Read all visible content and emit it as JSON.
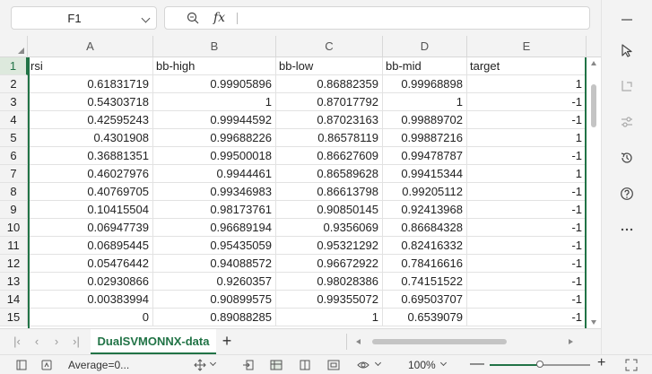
{
  "formula_bar": {
    "name_box": "F1",
    "fx_label": "fx",
    "formula_value": ""
  },
  "columns": [
    "A",
    "B",
    "C",
    "D",
    "E"
  ],
  "rows": [
    {
      "num": "1",
      "cells": [
        "rsi",
        "bb-high",
        "bb-low",
        "bb-mid",
        "target"
      ]
    },
    {
      "num": "2",
      "cells": [
        "0.61831719",
        "0.99905896",
        "0.86882359",
        "0.99968898",
        "1"
      ]
    },
    {
      "num": "3",
      "cells": [
        "0.54303718",
        "1",
        "0.87017792",
        "1",
        "-1"
      ]
    },
    {
      "num": "4",
      "cells": [
        "0.42595243",
        "0.99944592",
        "0.87023163",
        "0.99889702",
        "-1"
      ]
    },
    {
      "num": "5",
      "cells": [
        "0.4301908",
        "0.99688226",
        "0.86578119",
        "0.99887216",
        "1"
      ]
    },
    {
      "num": "6",
      "cells": [
        "0.36881351",
        "0.99500018",
        "0.86627609",
        "0.99478787",
        "-1"
      ]
    },
    {
      "num": "7",
      "cells": [
        "0.46027976",
        "0.9944461",
        "0.86589628",
        "0.99415344",
        "1"
      ]
    },
    {
      "num": "8",
      "cells": [
        "0.40769705",
        "0.99346983",
        "0.86613798",
        "0.99205112",
        "-1"
      ]
    },
    {
      "num": "9",
      "cells": [
        "0.10415504",
        "0.98173761",
        "0.90850145",
        "0.92413968",
        "-1"
      ]
    },
    {
      "num": "10",
      "cells": [
        "0.06947739",
        "0.96689194",
        "0.9356069",
        "0.86684328",
        "-1"
      ]
    },
    {
      "num": "11",
      "cells": [
        "0.06895445",
        "0.95435059",
        "0.95321292",
        "0.82416332",
        "-1"
      ]
    },
    {
      "num": "12",
      "cells": [
        "0.05476442",
        "0.94088572",
        "0.96672922",
        "0.78416616",
        "-1"
      ]
    },
    {
      "num": "13",
      "cells": [
        "0.02930866",
        "0.9260357",
        "0.98028386",
        "0.74151522",
        "-1"
      ]
    },
    {
      "num": "14",
      "cells": [
        "0.00383994",
        "0.90899575",
        "0.99355072",
        "0.69503707",
        "-1"
      ]
    },
    {
      "num": "15",
      "cells": [
        "0",
        "0.89088285",
        "1",
        "0.6539079",
        "-1"
      ]
    }
  ],
  "sheet_tab": {
    "name": "DualSVMONNX-data",
    "add_label": "+"
  },
  "statusbar": {
    "average": "Average=0...",
    "zoom": "100%",
    "zoom_fraction": 0.5,
    "minus": "—",
    "plus": "+"
  },
  "side_panel": {
    "icons": [
      "minimize-icon",
      "cursor-icon",
      "corner-arrow-icon",
      "sliders-icon",
      "history-icon",
      "help-icon",
      "more-icon"
    ]
  },
  "colors": {
    "accent": "#217346"
  }
}
